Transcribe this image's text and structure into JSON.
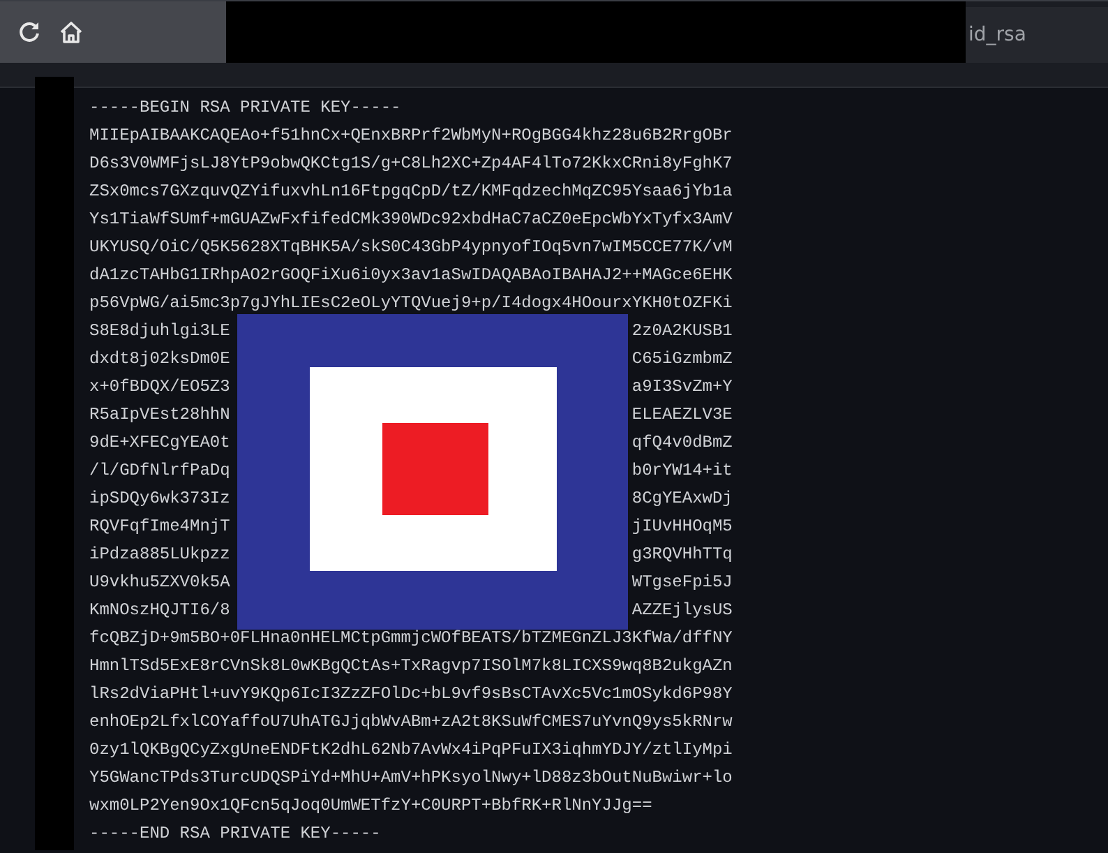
{
  "toolbar": {
    "buttons": [
      {
        "kind": "reload"
      },
      {
        "kind": "home"
      }
    ]
  },
  "tab": {
    "title": "id_rsa"
  },
  "lines": [
    {
      "kind": "full",
      "text": "-----BEGIN RSA PRIVATE KEY-----"
    },
    {
      "kind": "full",
      "text": "MIIEpAIBAAKCAQEAo+f51hnCx+QEnxBRPrf2WbMyN+ROgBGG4khz28u6B2RrgOBr"
    },
    {
      "kind": "full",
      "text": "D6s3V0WMFjsLJ8YtP9obwQKCtg1S/g+C8Lh2XC+Zp4AF4lTo72KkxCRni8yFghK7"
    },
    {
      "kind": "full",
      "text": "ZSx0mcs7GXzquvQZYifuxvhLn16FtpgqCpD/tZ/KMFqdzechMqZC95Ysaa6jYb1a"
    },
    {
      "kind": "full",
      "text": "Ys1TiaWfSUmf+mGUAZwFxfifedCMk390WDc92xbdHaC7aCZ0eEpcWbYxTyfx3AmV"
    },
    {
      "kind": "full",
      "text": "UKYUSQ/OiC/Q5K5628XTqBHK5A/skS0C43GbP4ypnyofIOq5vn7wIM5CCE77K/vM"
    },
    {
      "kind": "full",
      "text": "dA1zcTAHbG1IRhpAO2rGOQFiXu6i0yx3av1aSwIDAQABAoIBAHAJ2++MAGce6EHK"
    },
    {
      "kind": "full",
      "text": "p56VpWG/ai5mc3p7gJYhLIEsC2eOLyYTQVuej9+p/I4dogx4HOourxYKH0tOZFKi"
    },
    {
      "kind": "split",
      "left": "S8E8djuhlgi3LE",
      "right": "2z0A2KUSB1"
    },
    {
      "kind": "split",
      "left": "dxdt8j02ksDm0E",
      "right": "C65iGzmbmZ"
    },
    {
      "kind": "split",
      "left": "x+0fBDQX/EO5Z3",
      "right": "a9I3SvZm+Y"
    },
    {
      "kind": "split",
      "left": "R5aIpVEst28hhN",
      "right": "ELEAEZLV3E"
    },
    {
      "kind": "split",
      "left": "9dE+XFECgYEA0t",
      "right": "qfQ4v0dBmZ"
    },
    {
      "kind": "split",
      "left": "/l/GDfNlrfPaDq",
      "right": "b0rYW14+it"
    },
    {
      "kind": "split",
      "left": "ipSDQy6wk373Iz",
      "right": "8CgYEAxwDj"
    },
    {
      "kind": "split",
      "left": "RQVFqfIme4MnjT",
      "right": "jIUvHHOqM5"
    },
    {
      "kind": "split",
      "left": "iPdza885LUkpzz",
      "right": "g3RQVHhTTq"
    },
    {
      "kind": "split",
      "left": "U9vkhu5ZXV0k5A",
      "right": "WTgseFpi5J"
    },
    {
      "kind": "split",
      "left": "KmNOszHQJTI6/8",
      "right": "AZZEjlysUS"
    },
    {
      "kind": "full",
      "text": "fcQBZjD+9m5BO+0FLHna0nHELMCtpGmmjcWOfBEATS/bTZMEGnZLJ3KfWa/dffNY"
    },
    {
      "kind": "full",
      "text": "HmnlTSd5ExE8rCVnSk8L0wKBgQCtAs+TxRagvp7ISOlM7k8LICXS9wq8B2ukgAZn"
    },
    {
      "kind": "full",
      "text": "lRs2dViaPHtl+uvY9KQp6IcI3ZzZFOlDc+bL9vf9sBsCTAvXc5Vc1mOSykd6P98Y"
    },
    {
      "kind": "full",
      "text": "enhOEp2LfxlCOYaffoU7UhATGJjqbWvABm+zA2t8KSuWfCMES7uYvnQ9ys5kRNrw"
    },
    {
      "kind": "full",
      "text": "0zy1lQKBgQCyZxgUneENDFtK2dhL62Nb7AvWx4iPqPFuIX3iqhmYDJY/ztlIyMpi"
    },
    {
      "kind": "full",
      "text": "Y5GWancTPds3TurcUDQSPiYd+MhU+AmV+hPKsyolNwy+lD88z3bOutNuBwiwr+lo"
    },
    {
      "kind": "full",
      "text": "wxm0LP2Yen9Ox1QFcn5qJoq0UmWETfzY+C0URPT+BbfRK+RlNnYJJg=="
    },
    {
      "kind": "full",
      "text": "-----END RSA PRIVATE KEY-----"
    }
  ]
}
